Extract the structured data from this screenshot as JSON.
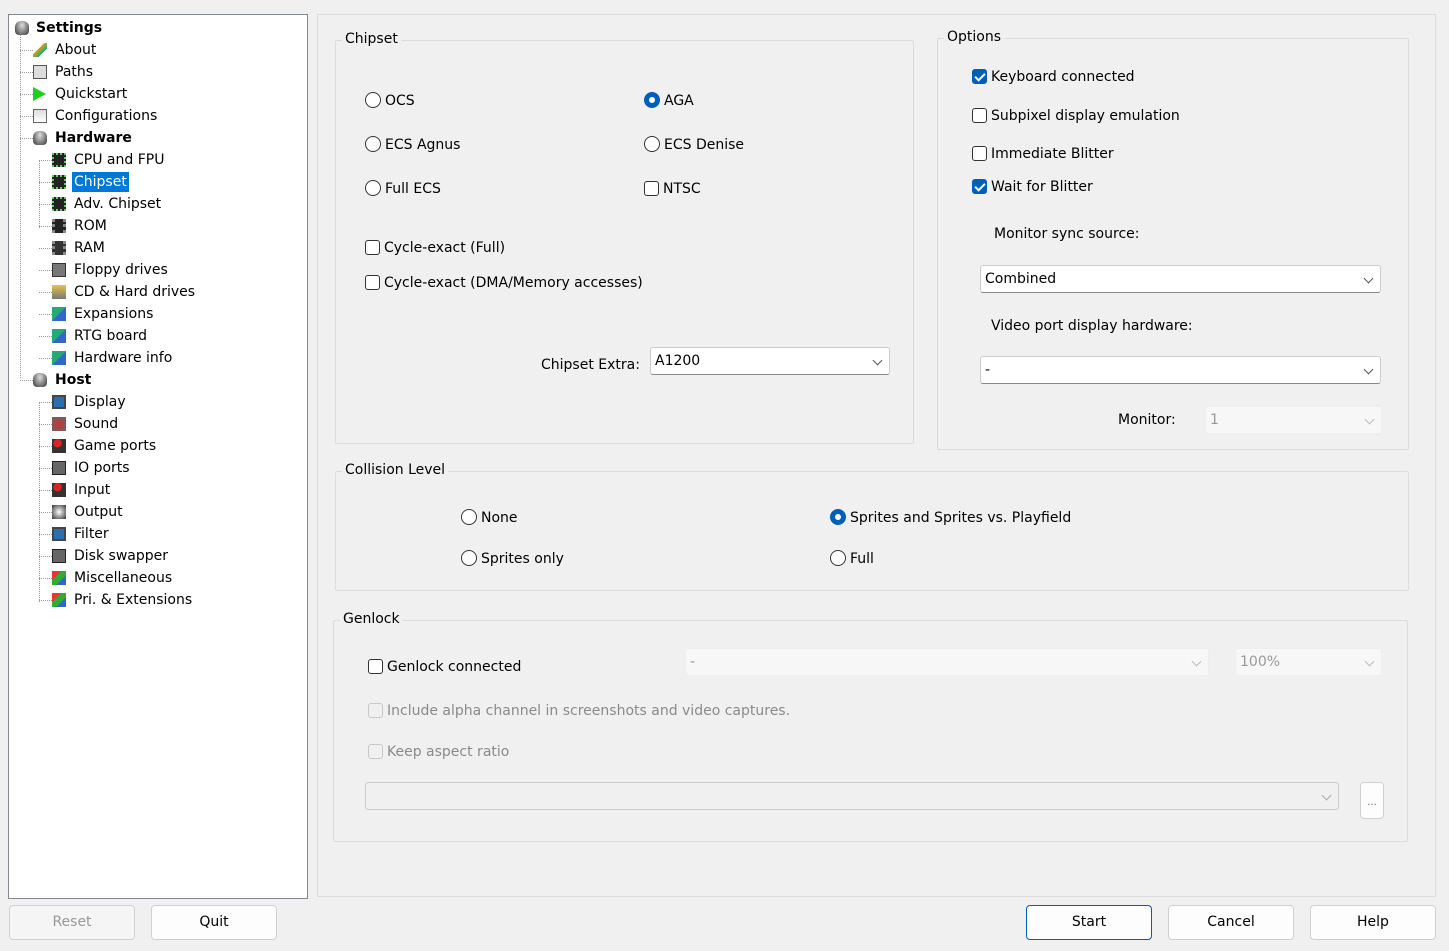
{
  "tree": [
    {
      "label": "Settings",
      "level": 0,
      "bold": true,
      "icon": "database-icon"
    },
    {
      "label": "About",
      "level": 1,
      "icon": "checkmark-icon"
    },
    {
      "label": "Paths",
      "level": 1,
      "icon": "paths-icon"
    },
    {
      "label": "Quickstart",
      "level": 1,
      "icon": "play-icon"
    },
    {
      "label": "Configurations",
      "level": 1,
      "icon": "configurations-icon"
    },
    {
      "label": "Hardware",
      "level": 1,
      "bold": true,
      "icon": "database-icon"
    },
    {
      "label": "CPU and FPU",
      "level": 2,
      "icon": "chip-icon"
    },
    {
      "label": "Chipset",
      "level": 2,
      "icon": "chip-icon",
      "selected": true
    },
    {
      "label": "Adv. Chipset",
      "level": 2,
      "icon": "chip-icon"
    },
    {
      "label": "ROM",
      "level": 2,
      "icon": "rom-icon"
    },
    {
      "label": "RAM",
      "level": 2,
      "icon": "ram-icon"
    },
    {
      "label": "Floppy drives",
      "level": 2,
      "icon": "floppy-icon"
    },
    {
      "label": "CD & Hard drives",
      "level": 2,
      "icon": "harddrive-icon"
    },
    {
      "label": "Expansions",
      "level": 2,
      "icon": "expansion-icon"
    },
    {
      "label": "RTG board",
      "level": 2,
      "icon": "expansion-icon"
    },
    {
      "label": "Hardware info",
      "level": 2,
      "icon": "expansion-icon"
    },
    {
      "label": "Host",
      "level": 1,
      "bold": true,
      "icon": "database-icon"
    },
    {
      "label": "Display",
      "level": 2,
      "icon": "display-icon"
    },
    {
      "label": "Sound",
      "level": 2,
      "icon": "sound-icon"
    },
    {
      "label": "Game ports",
      "level": 2,
      "icon": "joystick-icon"
    },
    {
      "label": "IO ports",
      "level": 2,
      "icon": "io-ports-icon"
    },
    {
      "label": "Input",
      "level": 2,
      "icon": "joystick-icon"
    },
    {
      "label": "Output",
      "level": 2,
      "icon": "output-icon"
    },
    {
      "label": "Filter",
      "level": 2,
      "icon": "display-icon"
    },
    {
      "label": "Disk swapper",
      "level": 2,
      "icon": "disk-swapper-icon"
    },
    {
      "label": "Miscellaneous",
      "level": 2,
      "icon": "misc-icon"
    },
    {
      "label": "Pri. & Extensions",
      "level": 2,
      "icon": "misc-icon"
    }
  ],
  "chipset": {
    "title": "Chipset",
    "ocs": "OCS",
    "aga": "AGA",
    "ecs_agnus": "ECS Agnus",
    "ecs_denise": "ECS Denise",
    "full_ecs": "Full ECS",
    "ntsc": "NTSC",
    "selected": "AGA",
    "ntsc_checked": false,
    "cycle_full": "Cycle-exact (Full)",
    "cycle_full_checked": false,
    "cycle_dma": "Cycle-exact (DMA/Memory accesses)",
    "cycle_dma_checked": false,
    "extra_label": "Chipset Extra:",
    "extra_value": "A1200"
  },
  "options": {
    "title": "Options",
    "keyboard": "Keyboard connected",
    "keyboard_checked": true,
    "subpixel": "Subpixel display emulation",
    "subpixel_checked": false,
    "immediate": "Immediate Blitter",
    "immediate_checked": false,
    "wait": "Wait for Blitter",
    "wait_checked": true,
    "sync_label": "Monitor sync source:",
    "sync_value": "Combined",
    "video_label": "Video port display hardware:",
    "video_value": "-",
    "monitor_label": "Monitor:",
    "monitor_value": "1"
  },
  "collision": {
    "title": "Collision Level",
    "none": "None",
    "sprites_pf": "Sprites and Sprites vs. Playfield",
    "sprites_only": "Sprites only",
    "full": "Full",
    "selected": "Sprites and Sprites vs. Playfield"
  },
  "genlock": {
    "title": "Genlock",
    "connected": "Genlock connected",
    "connected_checked": false,
    "mode_value": "-",
    "percent_value": "100%",
    "alpha": "Include alpha channel in screenshots and video captures.",
    "aspect": "Keep aspect ratio",
    "file_value": "",
    "browse": "..."
  },
  "buttons": {
    "reset": "Reset",
    "quit": "Quit",
    "start": "Start",
    "cancel": "Cancel",
    "help": "Help"
  },
  "colors": {
    "accent": "#005fb8",
    "selection": "#0078d7"
  }
}
